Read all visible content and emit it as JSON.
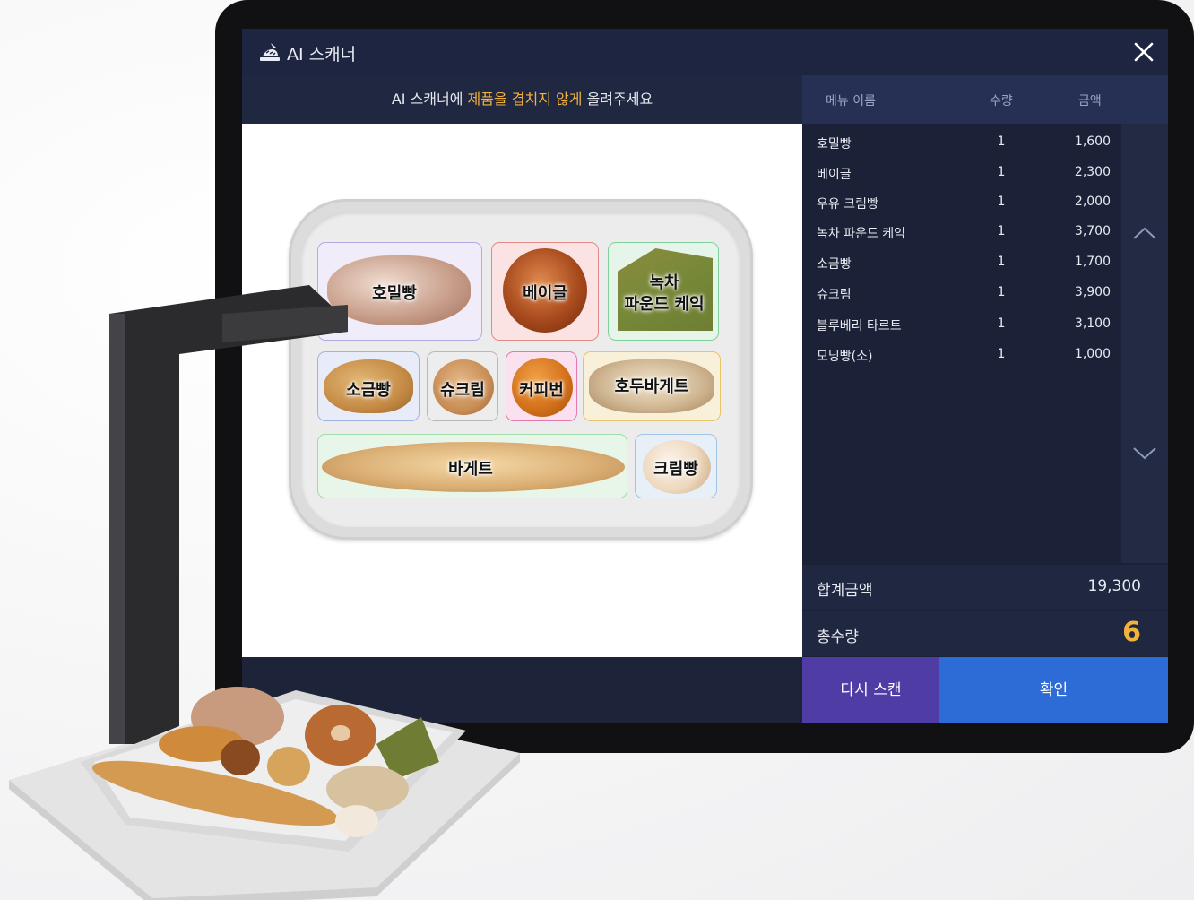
{
  "window": {
    "title": "AI 스캐너",
    "close_icon": "close-icon"
  },
  "instruction": {
    "prefix": "AI 스캐너에 ",
    "highlight": "제품을 겹치지 않게",
    "suffix": " 올려주세요"
  },
  "tray_items": [
    {
      "label": "호밀빵"
    },
    {
      "label": "베이글"
    },
    {
      "label_line1": "녹차",
      "label_line2": "파운드 케익"
    },
    {
      "label": "소금빵"
    },
    {
      "label": "슈크림"
    },
    {
      "label": "커피번"
    },
    {
      "label": "호두바게트"
    },
    {
      "label": "바게트"
    },
    {
      "label": "크림빵"
    }
  ],
  "order_table": {
    "headers": {
      "name": "메뉴 이름",
      "qty": "수량",
      "price": "금액"
    },
    "rows": [
      {
        "name": "호밀빵",
        "qty": "1",
        "price": "1,600"
      },
      {
        "name": "베이글",
        "qty": "1",
        "price": "2,300"
      },
      {
        "name": "우유 크림빵",
        "qty": "1",
        "price": "2,000"
      },
      {
        "name": "녹차 파운드 케익",
        "qty": "1",
        "price": "3,700"
      },
      {
        "name": "소금빵",
        "qty": "1",
        "price": "1,700"
      },
      {
        "name": "슈크림",
        "qty": "1",
        "price": "3,900"
      },
      {
        "name": "블루베리 타르트",
        "qty": "1",
        "price": "3,100"
      },
      {
        "name": "모닝빵(소)",
        "qty": "1",
        "price": "1,000"
      }
    ]
  },
  "summary": {
    "total_amount_label": "합계금액",
    "total_amount": "19,300",
    "total_qty_label": "총수량",
    "total_qty": "6"
  },
  "buttons": {
    "rescan": "다시 스캔",
    "confirm": "확인"
  },
  "colors": {
    "highlight": "#f2b33d",
    "rescan_bg": "#4f3ca5",
    "confirm_bg": "#2d6bd6",
    "panel_bg": "#1b2238",
    "qty_accent": "#f2b33d"
  }
}
